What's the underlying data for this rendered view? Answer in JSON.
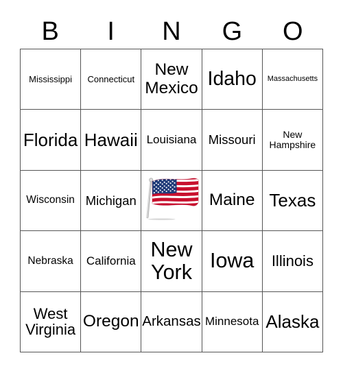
{
  "header": {
    "letters": [
      "B",
      "I",
      "N",
      "G",
      "O"
    ]
  },
  "grid": {
    "columns": 5,
    "rows": 5,
    "free_space": {
      "position": "center",
      "icon": "us-flag-icon",
      "label": ""
    },
    "cells": [
      {
        "label": "Mississippi",
        "size": "fs-s"
      },
      {
        "label": "Connecticut",
        "size": "fs-s"
      },
      {
        "label": "New Mexico",
        "size": "fs-xl"
      },
      {
        "label": "Idaho",
        "size": "fs-xxl"
      },
      {
        "label": "Massachusetts",
        "size": "fs-xs"
      },
      {
        "label": "Florida",
        "size": "fs-xl2"
      },
      {
        "label": "Hawaii",
        "size": "fs-xl2"
      },
      {
        "label": "Louisiana",
        "size": "fs-m2"
      },
      {
        "label": "Missouri",
        "size": "fs-m3"
      },
      {
        "label": "New Hampshire",
        "size": "fs-s2"
      },
      {
        "label": "Wisconsin",
        "size": "fs-m"
      },
      {
        "label": "Michigan",
        "size": "fs-m3"
      },
      {
        "label": "",
        "size": "fs-m",
        "free": true
      },
      {
        "label": "Maine",
        "size": "fs-xl"
      },
      {
        "label": "Texas",
        "size": "fs-xl2"
      },
      {
        "label": "Nebraska",
        "size": "fs-m"
      },
      {
        "label": "California",
        "size": "fs-m2"
      },
      {
        "label": "New York",
        "size": "fs-xxl2"
      },
      {
        "label": "Iowa",
        "size": "fs-xxl2"
      },
      {
        "label": "Illinois",
        "size": "fs-l2"
      },
      {
        "label": "West Virginia",
        "size": "fs-l2"
      },
      {
        "label": "Oregon",
        "size": "fs-xl"
      },
      {
        "label": "Arkansas",
        "size": "fs-l"
      },
      {
        "label": "Minnesota",
        "size": "fs-m2"
      },
      {
        "label": "Alaska",
        "size": "fs-xl2"
      }
    ]
  },
  "colors": {
    "border": "#555555",
    "text": "#000000",
    "background": "#ffffff",
    "flag_red": "#c8102e",
    "flag_blue": "#1f3a78",
    "flag_white": "#ffffff",
    "flag_pole": "#b9b9b9"
  }
}
